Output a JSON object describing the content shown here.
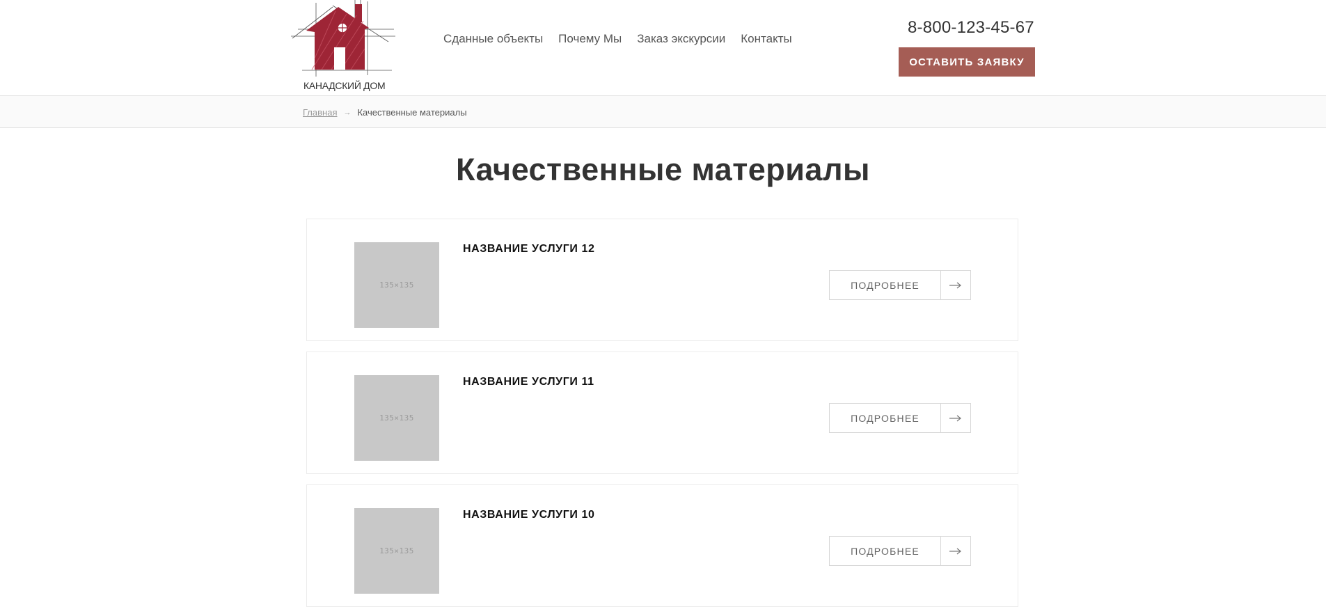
{
  "header": {
    "logo_text": "КАНАДСКИЙ ДОМ",
    "nav": [
      "Сданные объекты",
      "Почему Мы",
      "Заказ экскурсии",
      "Контакты"
    ],
    "phone": "8-800-123-45-67",
    "cta_label": "ОСТАВИТЬ ЗАЯВКУ"
  },
  "breadcrumb": {
    "home": "Главная",
    "separator": "→",
    "current": "Качественные материалы"
  },
  "page_title": "Качественные материалы",
  "services": [
    {
      "title": "НАЗВАНИЕ УСЛУГИ 12",
      "thumb_label": "135×135",
      "more_label": "ПОДРОБНЕЕ"
    },
    {
      "title": "НАЗВАНИЕ УСЛУГИ 11",
      "thumb_label": "135×135",
      "more_label": "ПОДРОБНЕЕ"
    },
    {
      "title": "НАЗВАНИЕ УСЛУГИ 10",
      "thumb_label": "135×135",
      "more_label": "ПОДРОБНЕЕ"
    }
  ],
  "colors": {
    "accent": "#a55d55",
    "logo_red": "#9e2536",
    "placeholder": "#c8c8c8"
  },
  "icons": {
    "logo": "house-sketch-logo",
    "arrow": "arrow-right-icon"
  }
}
